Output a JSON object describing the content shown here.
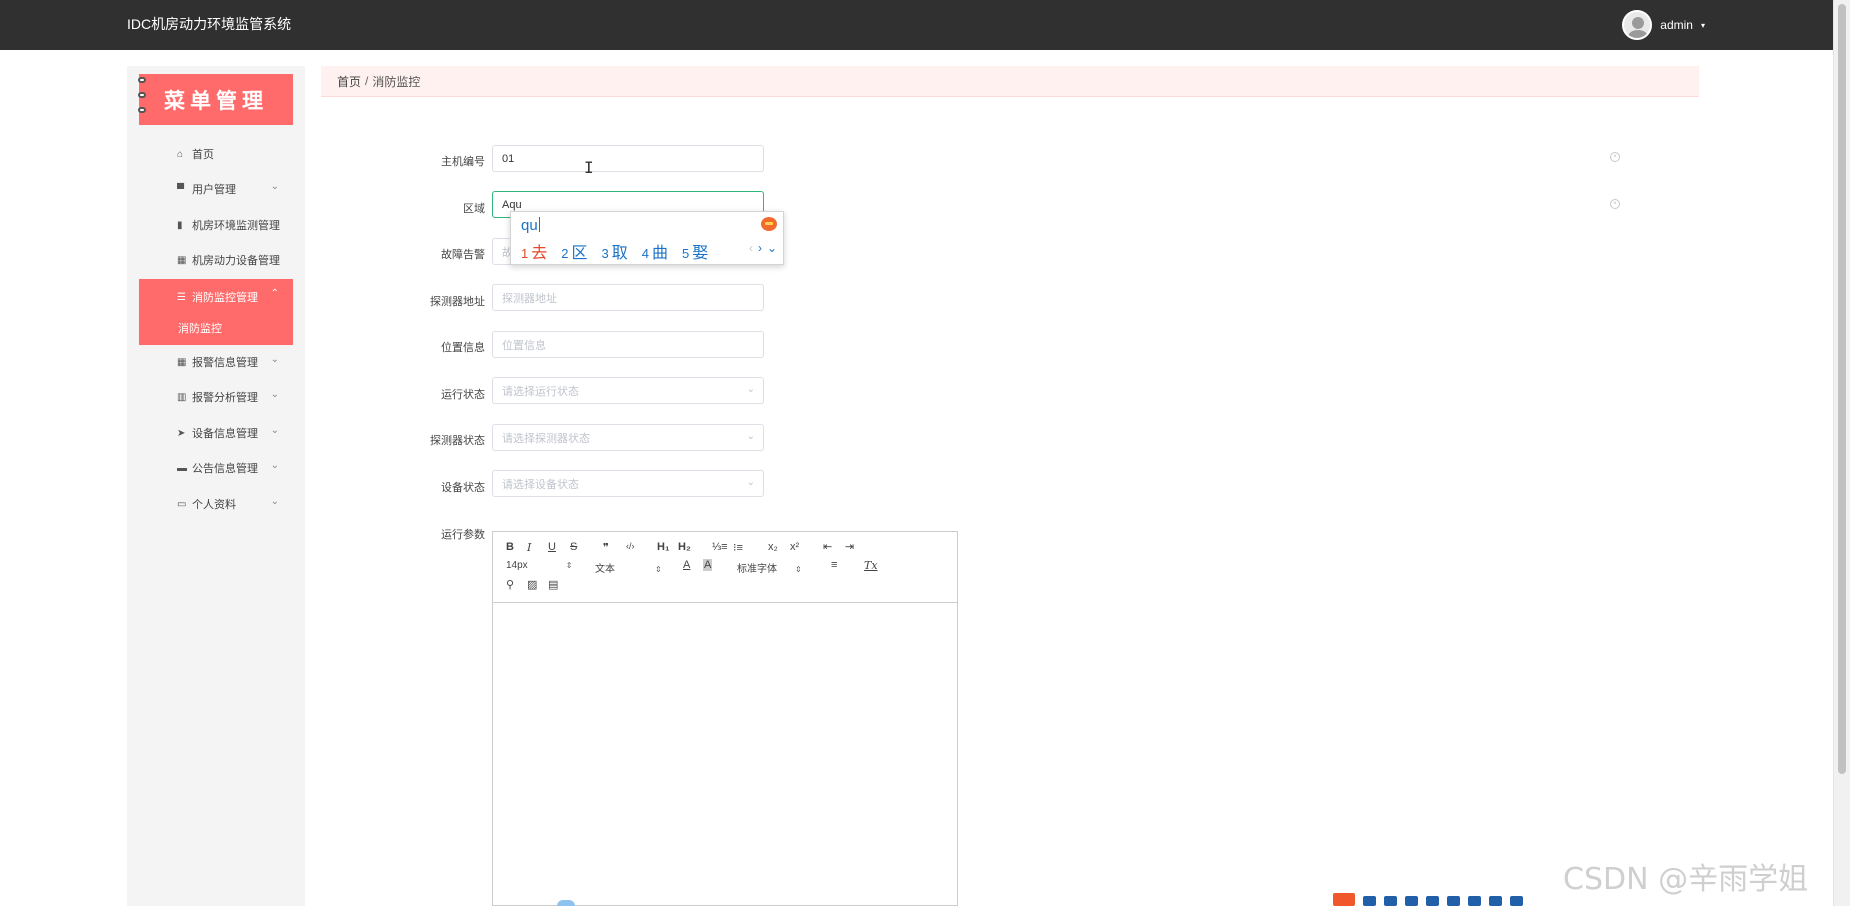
{
  "header": {
    "app_title": "IDC机房动力环境监管系统",
    "user_name": "admin",
    "user_caret": "▾"
  },
  "sidebar": {
    "banner_title": "菜单管理",
    "items": [
      {
        "label": "首页",
        "icon": "home-icon",
        "glyph": "⌂",
        "has_chevron": false
      },
      {
        "label": "用户管理",
        "icon": "comment-icon",
        "glyph": "▀",
        "has_chevron": true
      },
      {
        "label": "机房环境监测管理",
        "icon": "book-icon",
        "glyph": "▮",
        "has_chevron": false
      },
      {
        "label": "机房动力设备管理",
        "icon": "grid-icon",
        "glyph": "▦",
        "has_chevron": false
      },
      {
        "label": "消防监控管理",
        "icon": "list-icon",
        "glyph": "☰",
        "has_chevron": true,
        "active": true
      },
      {
        "label": "报警信息管理",
        "icon": "grid-icon",
        "glyph": "▦",
        "has_chevron": true
      },
      {
        "label": "报警分析管理",
        "icon": "bar-chart-icon",
        "glyph": "▥",
        "has_chevron": true
      },
      {
        "label": "设备信息管理",
        "icon": "send-icon",
        "glyph": "➤",
        "has_chevron": true
      },
      {
        "label": "公告信息管理",
        "icon": "ticket-icon",
        "glyph": "▬",
        "has_chevron": true
      },
      {
        "label": "个人资料",
        "icon": "card-icon",
        "glyph": "▭",
        "has_chevron": true
      }
    ],
    "active_sub": "消防监控",
    "chevron_down": "⌄",
    "chevron_up": "⌃"
  },
  "breadcrumb": {
    "home": "首页",
    "separator": "/",
    "current": "消防监控"
  },
  "form": {
    "host_no": {
      "label": "主机编号",
      "value": "01"
    },
    "area": {
      "label": "区域",
      "value": "Aqu"
    },
    "fault_alarm": {
      "label": "故障告警",
      "placeholder": "故"
    },
    "detector_addr": {
      "label": "探测器地址",
      "placeholder": "探测器地址"
    },
    "location": {
      "label": "位置信息",
      "placeholder": "位置信息"
    },
    "run_status": {
      "label": "运行状态",
      "placeholder": "请选择运行状态"
    },
    "detector_status": {
      "label": "探测器状态",
      "placeholder": "请选择探测器状态"
    },
    "device_status": {
      "label": "设备状态",
      "placeholder": "请选择设备状态"
    },
    "run_params": {
      "label": "运行参数"
    }
  },
  "ime": {
    "composition": "qu",
    "candidates": [
      {
        "num": "1",
        "text": "去"
      },
      {
        "num": "2",
        "text": "区"
      },
      {
        "num": "3",
        "text": "取"
      },
      {
        "num": "4",
        "text": "曲"
      },
      {
        "num": "5",
        "text": "娶"
      }
    ],
    "prev": "‹",
    "next": "›",
    "expand": "⌄"
  },
  "editor": {
    "font_size": "14px",
    "paragraph": "文本",
    "font_family": "标准字体",
    "bold": "B",
    "italic": "I",
    "underline": "U",
    "strike": "S",
    "quote": "❞",
    "code": "‹/›",
    "h1": "H₁",
    "h2": "H₂",
    "ol": "⅓≡",
    "ul": "⁝≡",
    "sub": "x₂",
    "sup": "x²",
    "indent_out": "⇤",
    "indent_in": "⇥",
    "font_color": "A",
    "bg_color": "A",
    "align": "≡",
    "clear_format": "Tx",
    "link": "⚲",
    "image": "▨",
    "video": "▤",
    "updown": "⇕"
  },
  "watermark": "CSDN @辛雨学姐"
}
